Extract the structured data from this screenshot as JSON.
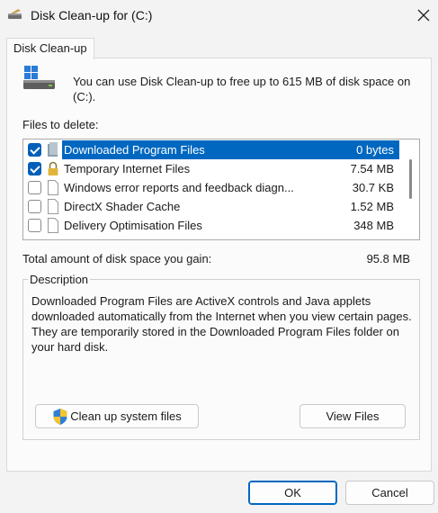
{
  "window": {
    "title": "Disk Clean-up for  (C:)",
    "close_icon": "close-icon"
  },
  "tab": {
    "label": "Disk Clean-up"
  },
  "intro": "You can use Disk Clean-up to free up to 615 MB of disk space on (C:).",
  "files_label": "Files to delete:",
  "files": [
    {
      "checked": true,
      "name": "Downloaded Program Files",
      "size": "0 bytes",
      "icon": "folder-icon",
      "selected": true
    },
    {
      "checked": true,
      "name": "Temporary Internet Files",
      "size": "7.54 MB",
      "icon": "lock-icon",
      "selected": false
    },
    {
      "checked": false,
      "name": "Windows error reports and feedback diagn...",
      "size": "30.7 KB",
      "icon": "file-icon",
      "selected": false
    },
    {
      "checked": false,
      "name": "DirectX Shader Cache",
      "size": "1.52 MB",
      "icon": "file-icon",
      "selected": false
    },
    {
      "checked": false,
      "name": "Delivery Optimisation Files",
      "size": "348 MB",
      "icon": "file-icon",
      "selected": false
    }
  ],
  "total": {
    "label": "Total amount of disk space you gain:",
    "value": "95.8 MB"
  },
  "description": {
    "legend": "Description",
    "text": "Downloaded Program Files are ActiveX controls and Java applets downloaded automatically from the Internet when you view certain pages. They are temporarily stored in the Downloaded Program Files folder on your hard disk."
  },
  "buttons": {
    "cleanup_system": "Clean up system files",
    "view_files": "View Files",
    "ok": "OK",
    "cancel": "Cancel"
  },
  "colors": {
    "accent": "#0067c0",
    "checkbox": "#005fb8"
  }
}
